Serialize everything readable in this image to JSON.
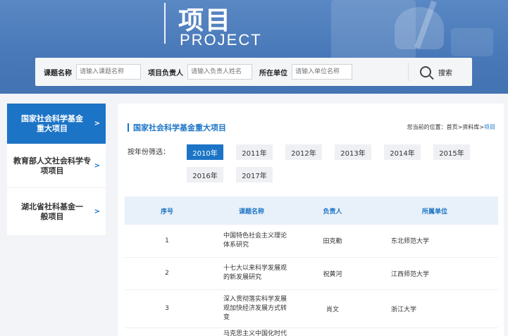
{
  "banner": {
    "title_cn": "项目",
    "title_en": "PROJECT"
  },
  "search": {
    "topic_label": "课题名称",
    "topic_placeholder": "请输入课题名称",
    "leader_label": "项目负责人",
    "leader_placeholder": "请输入负责人姓名",
    "unit_label": "所在单位",
    "unit_placeholder": "请输入单位名称",
    "button_label": "搜索"
  },
  "sidebar": {
    "items": [
      {
        "label": "国家社会科学基金重大项目",
        "arrow": ">"
      },
      {
        "label": "教育部人文社会科学专项项目",
        "arrow": ">"
      },
      {
        "label": "湖北省社科基金一般项目",
        "arrow": ">"
      }
    ]
  },
  "main": {
    "title": "国家社会科学基金重大项目",
    "breadcrumb_prefix": "您当前的位置：首页>资料库>",
    "breadcrumb_current": "项目",
    "filter_label": "按年份筛选：",
    "years": [
      "2010年",
      "2011年",
      "2012年",
      "2013年",
      "2014年",
      "2015年",
      "2016年",
      "2017年"
    ],
    "active_year": "2010年",
    "table": {
      "headers": [
        "序号",
        "课题名称",
        "负责人",
        "所属单位"
      ],
      "rows": [
        {
          "no": "1",
          "name": "中国特色社会主义理论体系研究",
          "leader": "田克勤",
          "unit": "东北师范大学"
        },
        {
          "no": "2",
          "name": "十七大以来科学发展观的新发展研究",
          "leader": "祝黄河",
          "unit": "江西师范大学"
        },
        {
          "no": "3",
          "name": "深入贯彻落实科学发展观加快经济发展方式转变",
          "leader": "肖文",
          "unit": "浙江大学"
        },
        {
          "no": "",
          "name": "马克思主义中国化时代",
          "leader": "",
          "unit": ""
        }
      ]
    }
  },
  "colors": {
    "accent": "#1c74c6",
    "banner": "#4878b8"
  }
}
